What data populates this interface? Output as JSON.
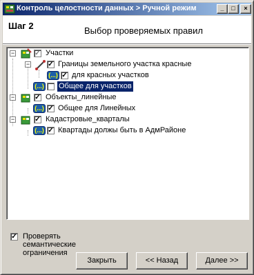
{
  "window": {
    "title": "Контроль целостности данных > Ручной режим",
    "minimize_glyph": "_",
    "maximize_glyph": "□",
    "close_glyph": "×"
  },
  "header": {
    "step": "Шаг 2",
    "description": "Выбор проверяемых правил"
  },
  "tree": {
    "nodes": [
      {
        "label": "Участки",
        "checked": "partial",
        "expanded": true
      },
      {
        "label": "Границы земельного участка красные",
        "checked": true,
        "expanded": true
      },
      {
        "label": "для красных участков",
        "checked": true
      },
      {
        "label": "Общее для участков",
        "checked": false,
        "selected": true
      },
      {
        "label": "Объекты_линейные",
        "checked": true,
        "expanded": true
      },
      {
        "label": "Общее для Линейных",
        "checked": true
      },
      {
        "label": "Кадастровые_кварталы",
        "checked": true,
        "expanded": true
      },
      {
        "label": "Квартады должы быть в АдмРайоне",
        "checked": true
      }
    ],
    "rule_icon_text": "(...)",
    "expander_open": "−",
    "check_mark": "✓"
  },
  "options": {
    "semantic_label": "Проверять семантические ограничения",
    "semantic_checked": true
  },
  "buttons": {
    "close": "Закрыть",
    "back": "<< Назад",
    "next": "Далее >>"
  },
  "colors": {
    "title_start": "#0a246a",
    "title_end": "#a6caf0",
    "dialog_bg": "#d4d0c8",
    "selection": "#0a246a"
  }
}
